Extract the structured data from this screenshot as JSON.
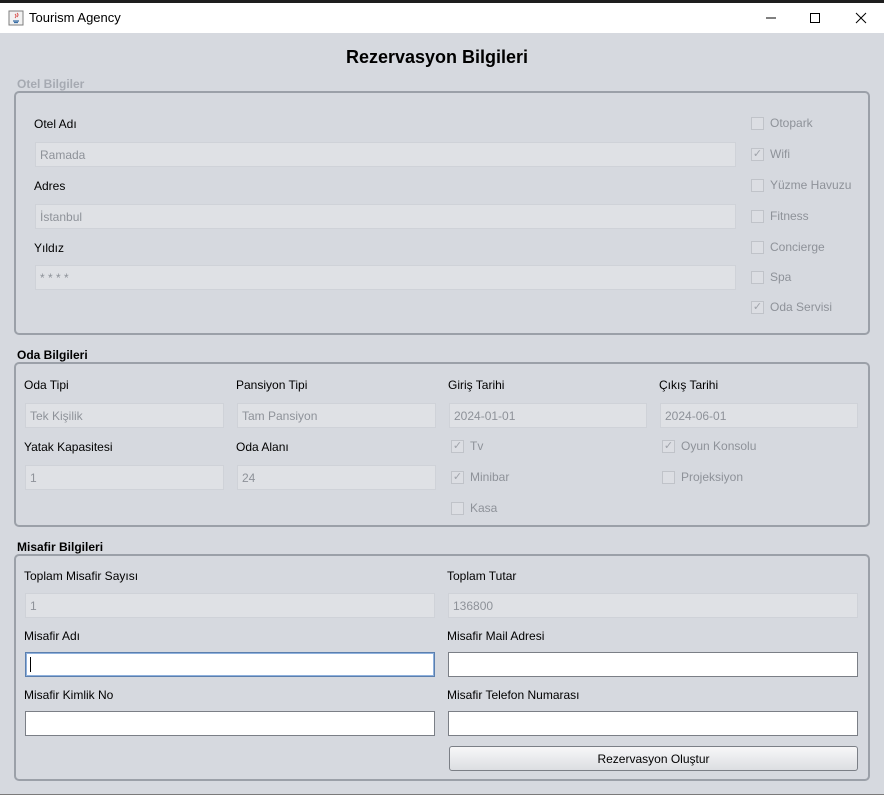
{
  "window": {
    "title": "Tourism Agency"
  },
  "heading": "Rezervasyon Bilgileri",
  "hotel": {
    "section_title": "Otel Bilgiler",
    "name_label": "Otel Adı",
    "name_value": "Ramada",
    "address_label": "Adres",
    "address_value": "İstanbul",
    "star_label": "Yıldız",
    "star_value": "* * * *",
    "features": [
      {
        "label": "Otopark",
        "checked": false
      },
      {
        "label": "Wifi",
        "checked": true
      },
      {
        "label": "Yüzme Havuzu",
        "checked": false
      },
      {
        "label": "Fitness",
        "checked": false
      },
      {
        "label": "Concierge",
        "checked": false
      },
      {
        "label": "Spa",
        "checked": false
      },
      {
        "label": "Oda Servisi",
        "checked": true
      }
    ]
  },
  "room": {
    "section_title": "Oda Bilgileri",
    "type_label": "Oda Tipi",
    "type_value": "Tek Kişilik",
    "pension_label": "Pansiyon Tipi",
    "pension_value": "Tam Pansiyon",
    "checkin_label": "Giriş Tarihi",
    "checkin_value": "2024-01-01",
    "checkout_label": "Çıkış Tarihi",
    "checkout_value": "2024-06-01",
    "bed_label": "Yatak Kapasitesi",
    "bed_value": "1",
    "area_label": "Oda Alanı",
    "area_value": "24",
    "features": [
      {
        "label": "Tv",
        "checked": true
      },
      {
        "label": "Minibar",
        "checked": true
      },
      {
        "label": "Kasa",
        "checked": false
      },
      {
        "label": "Oyun Konsolu",
        "checked": true
      },
      {
        "label": "Projeksiyon",
        "checked": false
      }
    ]
  },
  "guest": {
    "section_title": "Misafir Bilgileri",
    "total_guest_label": "Toplam Misafir Sayısı",
    "total_guest_value": "1",
    "total_price_label": "Toplam Tutar",
    "total_price_value": "136800",
    "name_label": "Misafir Adı",
    "name_value": "",
    "mail_label": "Misafir Mail Adresi",
    "mail_value": "",
    "id_label": "Misafir Kimlik No",
    "id_value": "",
    "phone_label": "Misafir Telefon Numarası",
    "phone_value": ""
  },
  "actions": {
    "create_label": "Rezervasyon Oluştur"
  },
  "colors": {
    "background": "#d6d9df",
    "disabled_text": "#8e9299",
    "focus_border": "#5b7fae"
  }
}
